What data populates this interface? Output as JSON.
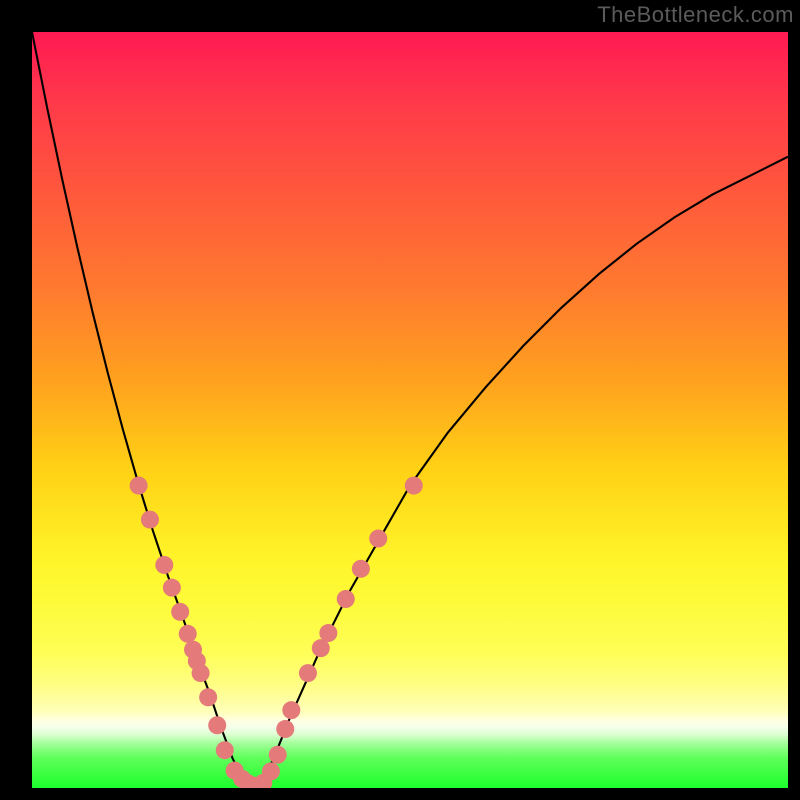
{
  "watermark": "TheBottleneck.com",
  "chart_data": {
    "type": "line",
    "title": "",
    "xlabel": "",
    "ylabel": "",
    "xlim": [
      0,
      100
    ],
    "ylim": [
      0,
      100
    ],
    "series": [
      {
        "name": "bottleneck-curve",
        "x": [
          0,
          2,
          4,
          6,
          8,
          10,
          12,
          14,
          16,
          18,
          20,
          22,
          23.5,
          25,
          26.5,
          28,
          30,
          32,
          34,
          38,
          42,
          46,
          50,
          55,
          60,
          65,
          70,
          75,
          80,
          85,
          90,
          95,
          100
        ],
        "y": [
          100,
          90,
          80.5,
          71.5,
          63,
          55,
          47.5,
          40.5,
          34,
          28,
          22.4,
          16.5,
          12.5,
          8,
          4,
          0.8,
          0,
          4,
          9,
          18,
          26,
          33,
          40,
          47,
          53,
          58.5,
          63.5,
          68,
          72,
          75.5,
          78.5,
          81,
          83.5
        ]
      }
    ],
    "scatter": {
      "name": "sample-dots",
      "color": "#e47a7a",
      "points": [
        {
          "x": 14.1,
          "y": 40
        },
        {
          "x": 15.6,
          "y": 35.5
        },
        {
          "x": 17.5,
          "y": 29.5
        },
        {
          "x": 18.5,
          "y": 26.5
        },
        {
          "x": 19.6,
          "y": 23.3
        },
        {
          "x": 20.6,
          "y": 20.4
        },
        {
          "x": 21.3,
          "y": 18.3
        },
        {
          "x": 21.8,
          "y": 16.8
        },
        {
          "x": 22.3,
          "y": 15.2
        },
        {
          "x": 23.3,
          "y": 12
        },
        {
          "x": 24.5,
          "y": 8.3
        },
        {
          "x": 25.5,
          "y": 5
        },
        {
          "x": 26.8,
          "y": 2.3
        },
        {
          "x": 27.8,
          "y": 1.2
        },
        {
          "x": 28.6,
          "y": 0.6
        },
        {
          "x": 29.6,
          "y": 0.3
        },
        {
          "x": 30.6,
          "y": 0.7
        },
        {
          "x": 31.6,
          "y": 2.2
        },
        {
          "x": 32.5,
          "y": 4.4
        },
        {
          "x": 33.5,
          "y": 7.8
        },
        {
          "x": 34.3,
          "y": 10.3
        },
        {
          "x": 36.5,
          "y": 15.2
        },
        {
          "x": 38.2,
          "y": 18.5
        },
        {
          "x": 39.2,
          "y": 20.5
        },
        {
          "x": 41.5,
          "y": 25
        },
        {
          "x": 43.5,
          "y": 29
        },
        {
          "x": 45.8,
          "y": 33
        },
        {
          "x": 50.5,
          "y": 40
        }
      ]
    }
  }
}
